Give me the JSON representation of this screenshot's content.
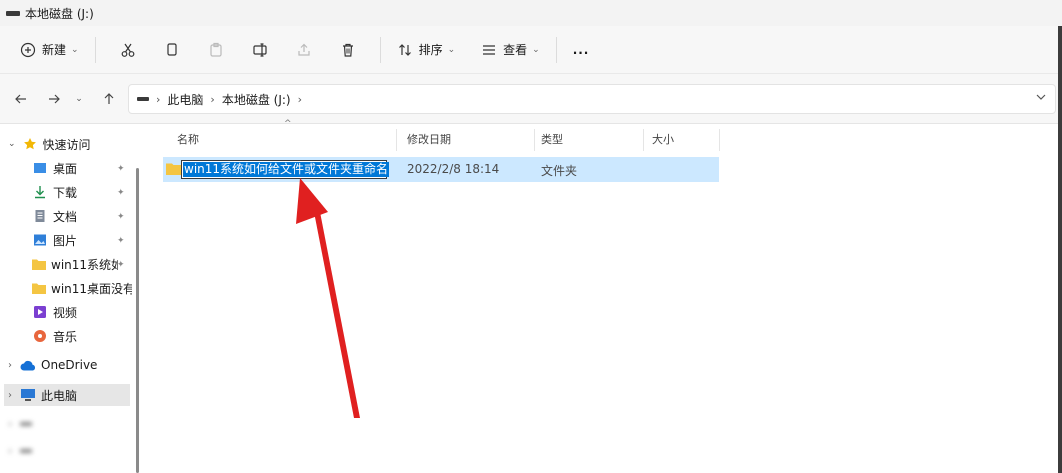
{
  "window": {
    "title": "本地磁盘 (J:)"
  },
  "toolbar": {
    "new_label": "新建",
    "sort_label": "排序",
    "view_label": "查看",
    "more_label": "..."
  },
  "address": {
    "breadcrumbs": [
      "此电脑",
      "本地磁盘 (J:)"
    ]
  },
  "sidebar": {
    "quick_access": "快速访问",
    "items": [
      {
        "label": "桌面",
        "pinned": true
      },
      {
        "label": "下载",
        "pinned": true
      },
      {
        "label": "文档",
        "pinned": true
      },
      {
        "label": "图片",
        "pinned": true
      },
      {
        "label": "win11系统如",
        "pinned": true
      },
      {
        "label": "win11桌面没有",
        "pinned": false
      },
      {
        "label": "视频",
        "pinned": false
      },
      {
        "label": "音乐",
        "pinned": false
      }
    ],
    "onedrive": "OneDrive",
    "this_pc": "此电脑"
  },
  "columns": {
    "name": "名称",
    "date": "修改日期",
    "type": "类型",
    "size": "大小"
  },
  "files": [
    {
      "name": "win11系统如何给文件或文件夹重命名",
      "date": "2022/2/8 18:14",
      "type": "文件夹",
      "size": ""
    }
  ],
  "colors": {
    "selection_row": "#cce8ff",
    "text_selection": "#0078d7",
    "annotation_arrow": "#e02020",
    "folder": "#f4c542"
  }
}
